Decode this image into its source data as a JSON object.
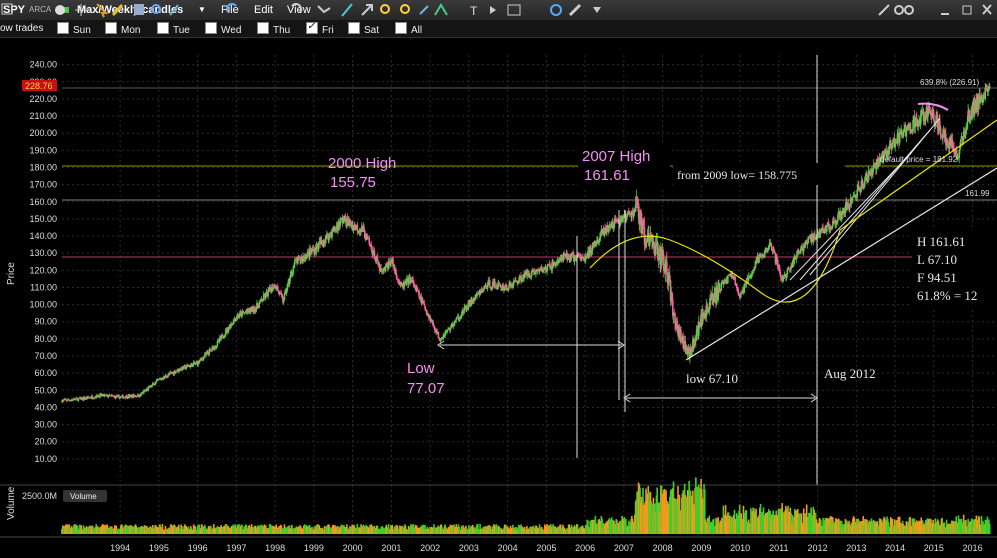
{
  "toolbar": {
    "symbol": "SPY",
    "exchange": "ARCA",
    "chart_preset": "Max/Weekly candles",
    "menu": [
      "File",
      "Edit",
      "View"
    ],
    "icons": [
      "box-icon",
      "circle-icon",
      "crosshair-icon",
      "pointer-icon",
      "pencil-icon",
      "select-icon",
      "zoom-icon",
      "eyedropper-icon",
      "undo-icon",
      "redo-icon",
      "refresh-icon",
      "fork-icon",
      "line-icon",
      "zoom-in-icon",
      "zoom-out-icon",
      "measure-icon",
      "text-icon",
      "expand-icon",
      "sync-icon",
      "wrench-icon",
      "dropdown-icon"
    ],
    "right_icons": [
      "wrench-icon",
      "link-icon",
      "minimize-icon",
      "restore-icon",
      "close-icon"
    ]
  },
  "days_bar": {
    "label": "ow trades",
    "days": [
      {
        "label": "Sun",
        "checked": false
      },
      {
        "label": "Mon",
        "checked": false
      },
      {
        "label": "Tue",
        "checked": false
      },
      {
        "label": "Wed",
        "checked": false
      },
      {
        "label": "Thu",
        "checked": false
      },
      {
        "label": "Fri",
        "checked": true
      },
      {
        "label": "Sat",
        "checked": false
      },
      {
        "label": "All",
        "checked": false
      }
    ]
  },
  "price_badge": "228.76",
  "volume_badge": "2500.0M",
  "volume_label": "Volume",
  "annotations": {
    "high2000_line1": "2000 High",
    "high2000_line2": "155.75",
    "high2007_line1": "2007 High",
    "high2007_line2": "161.61",
    "from2009": "from 2009 low= 158.775",
    "low_line1": "Low",
    "low_line2": "77.07",
    "low2009": "low 67.10",
    "aug2012": "Aug 2012",
    "fib_top": "639.8% (226.91)",
    "fib_default": "default price = 181.92",
    "fib_161": "161.99",
    "hlf": [
      "H 161.61",
      "L 67.10",
      "F 94.51",
      "61.8% = 12"
    ]
  },
  "colors": {
    "up": "#4bd93a",
    "down": "#ff5fa2",
    "volume_orange": "#f39a1c",
    "volume_green": "#3fcf2c",
    "fib_yellow": "#c8c800",
    "red_line": "#d03060",
    "annotation_pink": "#f58ef5",
    "trend_white": "#e8e8e8"
  },
  "chart_data": [
    {
      "type": "candlestick",
      "title": "",
      "xlabel": "",
      "ylabel": "Price",
      "ylim": [
        0,
        245
      ],
      "yticks": [
        "10.00",
        "20.00",
        "30.00",
        "40.00",
        "50.00",
        "60.00",
        "70.00",
        "80.00",
        "90.00",
        "100.00",
        "110.00",
        "120.00",
        "130.00",
        "140.00",
        "150.00",
        "160.00",
        "170.00",
        "180.00",
        "190.00",
        "200.00",
        "210.00",
        "220.00",
        "230.00",
        "240.00"
      ],
      "xticks": [
        "1994",
        "1995",
        "1996",
        "1997",
        "1998",
        "1999",
        "2000",
        "2001",
        "2002",
        "2003",
        "2004",
        "2005",
        "2006",
        "2007",
        "2008",
        "2009",
        "2010",
        "2011",
        "2012",
        "2013",
        "2014",
        "2015",
        "2016"
      ],
      "xlim": [
        1993.0,
        2016.95
      ],
      "grid": true,
      "series": [
        {
          "x": [
            1993.0,
            1993.5,
            1994.0,
            1994.5,
            1995.0,
            1995.5,
            1996.0,
            1996.5,
            1997.0,
            1997.5,
            1998.0,
            1998.5,
            1998.7,
            1999.0,
            1999.5,
            2000.0,
            2000.25,
            2000.5,
            2000.75,
            2001.0,
            2001.25,
            2001.5,
            2001.75,
            2002.0,
            2002.5,
            2002.75,
            2003.0,
            2003.5,
            2004.0,
            2004.5,
            2005.0,
            2005.5,
            2006.0,
            2006.5,
            2007.0,
            2007.5,
            2007.8,
            2008.0,
            2008.3,
            2008.6,
            2008.8,
            2009.0,
            2009.2,
            2009.5,
            2010.0,
            2010.3,
            2010.5,
            2010.8,
            2011.0,
            2011.3,
            2011.6,
            2011.8,
            2012.0,
            2012.3,
            2012.6,
            2013.0,
            2013.5,
            2014.0,
            2014.5,
            2015.0,
            2015.4,
            2015.6,
            2015.8,
            2016.0,
            2016.1,
            2016.4,
            2016.6,
            2016.95
          ],
          "close": [
            44,
            45,
            47,
            46,
            47,
            56,
            62,
            66,
            77,
            93,
            98,
            112,
            102,
            124,
            132,
            143,
            150,
            146,
            144,
            132,
            118,
            126,
            110,
            115,
            92,
            80,
            86,
            100,
            112,
            110,
            118,
            121,
            128,
            127,
            144,
            150,
            156,
            142,
            136,
            122,
            92,
            80,
            70,
            92,
            110,
            118,
            104,
            120,
            128,
            134,
            114,
            122,
            130,
            138,
            142,
            150,
            165,
            182,
            196,
            206,
            213,
            205,
            196,
            193,
            186,
            210,
            217,
            226
          ]
        }
      ]
    },
    {
      "type": "bar",
      "title": "",
      "ylabel": "Volume",
      "yticks": [
        "2500.0M"
      ],
      "note": "weekly volume, peaks during 2008-2009"
    }
  ]
}
